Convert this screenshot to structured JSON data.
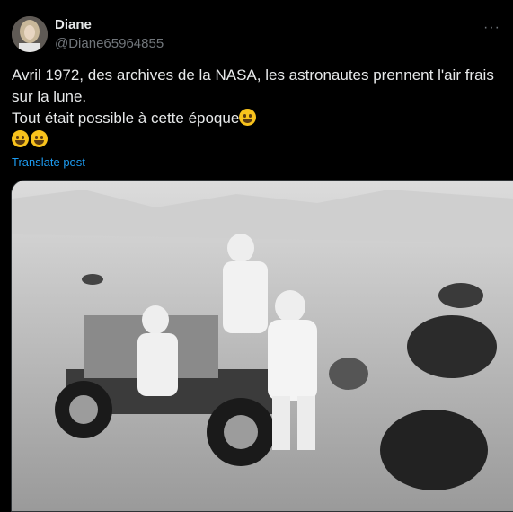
{
  "author": {
    "display_name": "Diane",
    "handle": "@Diane65964855",
    "avatar_icon": "user-avatar"
  },
  "menu": {
    "more_label": "···"
  },
  "post": {
    "line1": "Avril 1972, des archives de la NASA, les astronautes prennent l'air frais",
    "line2": "sur la lune.",
    "line3": "Tout était possible à cette époque",
    "line3_emoji": "upside-down-face-emoji",
    "line4_emojis": [
      "grinning-face-emoji",
      "rolling-on-floor-laughing-emoji"
    ]
  },
  "translate_label": "Translate post",
  "media": {
    "type": "black-and-white photo",
    "subject": "three astronauts with lunar roving vehicle"
  },
  "colors": {
    "background": "#000000",
    "link": "#1d9bf0",
    "text": "#e7e9ea",
    "muted": "#71767b"
  }
}
